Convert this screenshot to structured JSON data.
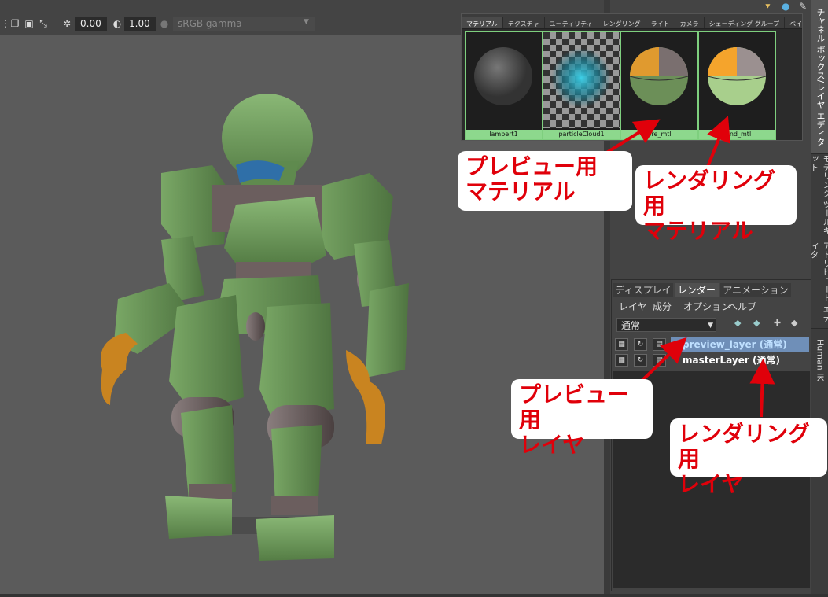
{
  "viewport_toolbar": {
    "exposure_value": "0.00",
    "gamma_value": "1.00",
    "color_space": "sRGB gamma"
  },
  "hypershade": {
    "tabs": [
      "マテリアル",
      "テクスチャ",
      "ユーティリティ",
      "レンダリング",
      "ライト",
      "カメラ",
      "シェーディング グループ",
      "ベイク セッ"
    ],
    "materials": [
      "lambert1",
      "particleCloud1",
      "pre_mtl",
      "rend_mtl"
    ]
  },
  "layer_editor": {
    "tabs": [
      "ディスプレイ",
      "レンダー",
      "アニメーション"
    ],
    "menus": [
      "レイヤ",
      "成分",
      "オプション",
      "ヘルプ"
    ],
    "mode": "通常",
    "layers": [
      {
        "name": "preview_layer (通常)"
      },
      {
        "name": "masterLayer (通常)"
      }
    ]
  },
  "side_tabs": [
    "チャネル ボックス/レイヤ エディタ",
    "モデリング ツールキット",
    "アトリビュート エディタ",
    "Human IK"
  ],
  "annotations": {
    "preview_material": [
      "プレビュー用",
      "マテリアル"
    ],
    "render_material": [
      "レンダリング用",
      "マテリアル"
    ],
    "preview_layer": [
      "プレビュー用",
      "レイヤ"
    ],
    "render_layer": [
      "レンダリング用",
      "レイヤ"
    ]
  },
  "colors": {
    "accent_red": "#e0000a",
    "material_label_green": "#8dd88d",
    "selected_layer_blue": "#6f8fb8",
    "robot_green": "#6f9a5c",
    "robot_orange": "#c98420"
  }
}
